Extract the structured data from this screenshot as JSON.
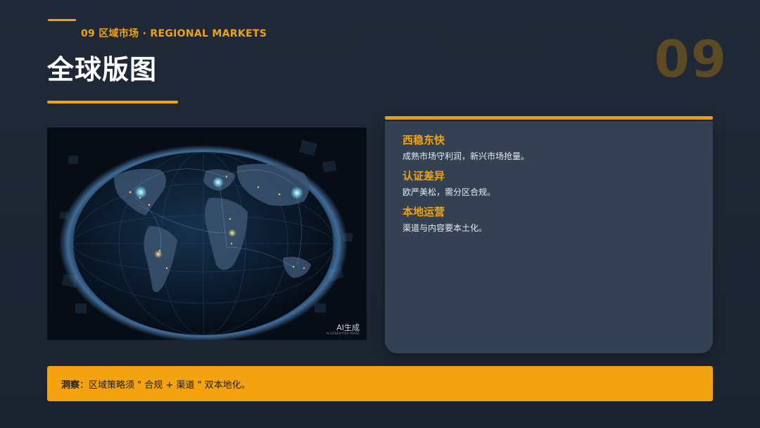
{
  "header": {
    "section_label": "09  区域市场 · REGIONAL MARKETS",
    "title": "全球版图",
    "page_number": "09"
  },
  "image": {
    "description": "globe-with-network-lights",
    "badge_main": "AI生成",
    "badge_sub": "AI GENERATED IMAGE"
  },
  "points": [
    {
      "title": "西稳东快",
      "desc": "成熟市场守利润，新兴市场抢量。"
    },
    {
      "title": "认证差异",
      "desc": "欧严美松，需分区合规。"
    },
    {
      "title": "本地运营",
      "desc": "渠道与内容要本土化。"
    }
  ],
  "insight": {
    "label": "洞察",
    "colon": "：",
    "text": "区域策略须 \" 合规 + 渠道 \" 双本地化。"
  },
  "colors": {
    "accent": "#f2a20b",
    "background": "#1f2937",
    "card": "#334152",
    "page_number": "#5b4a23"
  }
}
